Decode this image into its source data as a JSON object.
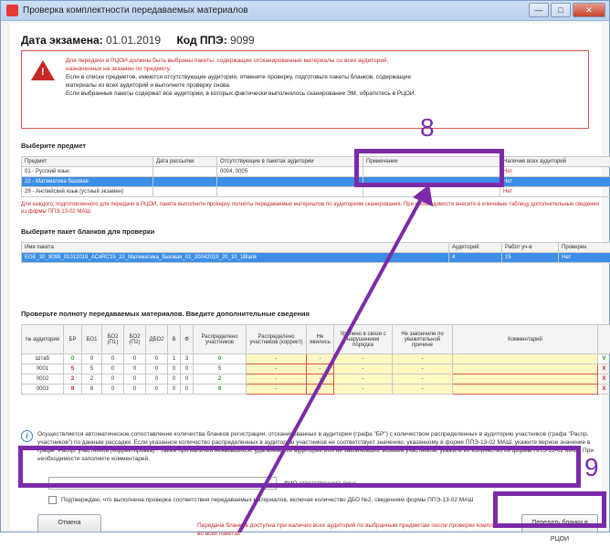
{
  "window": {
    "title": "Проверка комплектности передаваемых материалов",
    "min": "—",
    "max": "□",
    "close": "✕"
  },
  "header": {
    "date_label": "Дата экзамена:",
    "date_value": "01.01.2019",
    "ppe_label": "Код ППЭ:",
    "ppe_value": "9099"
  },
  "warning": {
    "line1": "Для передачи в РЦОИ должны быть выбраны пакеты, содержащие отсканированные материалы со всех аудиторий,",
    "line2": "назначенных на экзамен по предмету.",
    "line3": "Если в списке предметов, имеются отсутствующие аудитории, отмените проверку, подготовьте пакеты бланков, содержащие",
    "line4": "материалы из всех аудиторий и выполните проверку снова.",
    "line5": "Если выбранные пакеты содержат все аудитории, в которых фактически выполнялось сканирование ЭМ, обратитесь в РЦОИ."
  },
  "subjects": {
    "section_title": "Выберите предмет",
    "headers": [
      "Предмет",
      "Дата рассылки",
      "Отсутствующие в пакетах аудитории",
      "Примечание",
      "Наличие всех аудиторий"
    ],
    "rows": [
      [
        "01 - Русский язык",
        "",
        "0004, 0005",
        "",
        "Нет"
      ],
      [
        "22 - Математика базовая",
        "",
        "",
        "",
        "Нет"
      ],
      [
        "29 - Английский язык (устный экзамен)",
        "",
        "",
        "",
        "Нет"
      ]
    ],
    "note": "Для каждого, подготовленного для передачи в РЦОИ, пакета выполните проверку полноты передаваемых материалов по аудиториям сканирования. При необходимости внесите в ключевые таблицу дополнительные сведения из формы ППЭ-13-02 МАШ."
  },
  "packages": {
    "section_title": "Выберите пакет бланков для проверки",
    "headers": [
      "Имя пакета",
      "Аудиторий",
      "Работ уч-в",
      "Проверен"
    ],
    "rows": [
      [
        "EGE_30_9099_01012019_AC4RC15_22_Математика_базовая_01_20042019_20_10_1Blank",
        "4",
        "15",
        "Нет"
      ]
    ]
  },
  "materials": {
    "section_title": "Проверьте полноту передаваемых материалов. Введите дополнительные сведения",
    "headers": [
      "№ аудитории",
      "БР",
      "БО1",
      "БО2 (П1)",
      "БО2 (П2)",
      "ДБО2",
      "В",
      "Ф",
      "Распределено участников",
      "Распределено участников (коррект)",
      "Не явились",
      "Удалено в связи с нарушением порядка",
      "Не закончили по уважительной причине",
      "Комментарий",
      ""
    ],
    "rows": [
      [
        "Штаб",
        "0",
        "0",
        "0",
        "0",
        "0",
        "1",
        "3",
        "0",
        "-",
        "-",
        "-",
        "-",
        "",
        "V"
      ],
      [
        "0001",
        "5",
        "5",
        "0",
        "0",
        "0",
        "0",
        "0",
        "5",
        "-",
        "-",
        "-",
        "-",
        "",
        "X"
      ],
      [
        "0002",
        "2",
        "2",
        "0",
        "0",
        "0",
        "0",
        "0",
        "2",
        "-",
        "-",
        "-",
        "-",
        "",
        "X"
      ],
      [
        "0003",
        "8",
        "8",
        "0",
        "0",
        "0",
        "0",
        "0",
        "8",
        "-",
        "-",
        "-",
        "-",
        "",
        "X"
      ]
    ]
  },
  "info": {
    "text": "Осуществляется автоматическое сопоставление количества бланков регистрации, отсканированных в аудитории (графа \"БР\") с количеством распределенных в аудиторию участников (графа \"Распр. участников\") по данным рассадки. Если указанное количество распределенных в аудиторию участников не соответствует значению, указанному в форме ППЭ-13-02 МАШ, укажите верное значение в графе \"Распр. участников (корректировка)\". Также при наличии неявившихся, удаленных из аудитории или не закончивших экзамен участников, укажите их количество из формы ППЭ-13-02 МАШ. При необходимости заполните комментарий."
  },
  "confirm": {
    "fio_label": "ФИО ответственного лица",
    "checkbox_label": "Подтверждаю, что выполнена проверка соответствия передаваемых материалов, включая количество ДБО №2, сведениям формы ППЭ-13-02 МАШ"
  },
  "buttons": {
    "cancel": "Отмена",
    "send": "Передать бланки в РЦОИ"
  },
  "footnote": "Передача бланков доступна при наличии всех аудиторий по выбранным предметам после проверки комплектности материалов во всех пакетах",
  "overlay": {
    "num8": "8",
    "num9": "9",
    "color": "#7b2aa8"
  }
}
